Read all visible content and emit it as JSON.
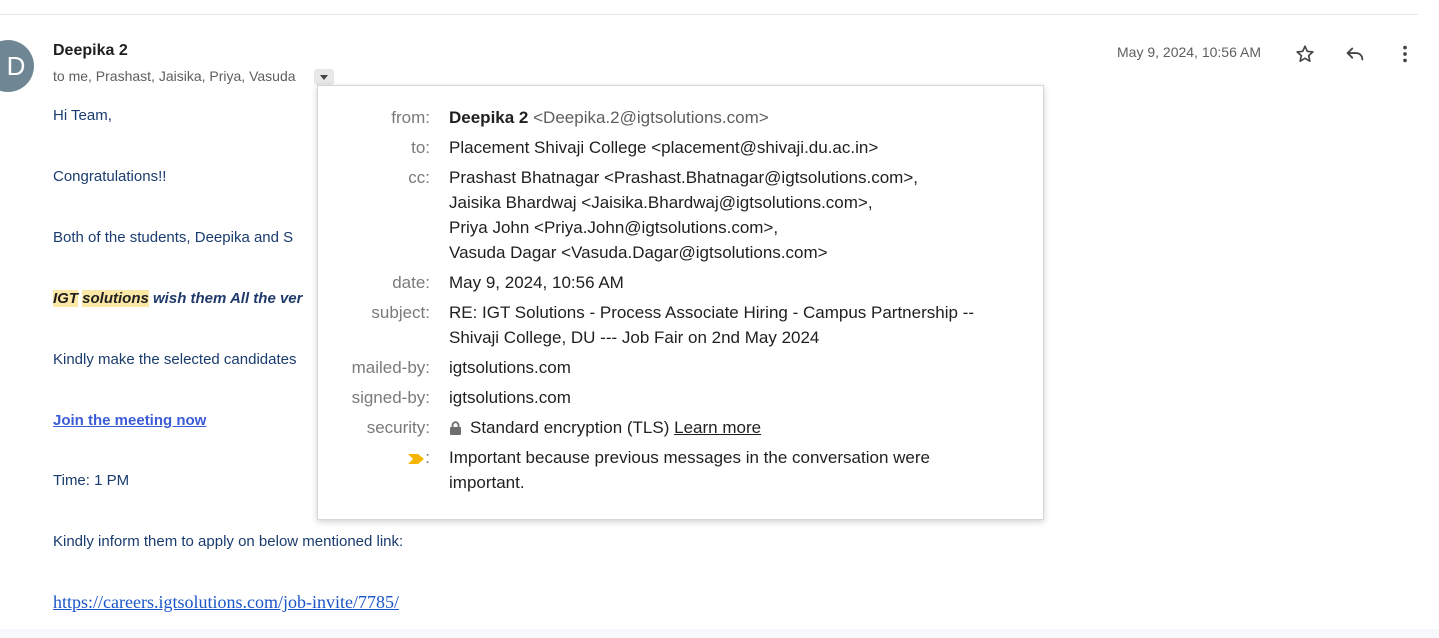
{
  "email": {
    "avatar_letter": "D",
    "sender": "Deepika 2",
    "recipients_summary": "to me, Prashast, Jaisika, Priya, Vasuda",
    "date": "May 9, 2024, 10:56 AM",
    "actions": {
      "star_icon": "star-icon",
      "reply_icon": "reply-icon",
      "more_icon": "more-vert-icon"
    },
    "body": {
      "greeting": "Hi Team,",
      "congrats": "Congratulations!!",
      "line3": "Both of the students, Deepika and S",
      "line4_hl1": "IGT",
      "line4_hl2": "solutions",
      "line4_rest": " wish them All the ver",
      "line5": "Kindly make the selected candidates",
      "meeting_link": "Join the meeting now",
      "time": "Time: 1 PM",
      "apply_text": "Kindly inform them to apply on below mentioned link:",
      "apply_url": "https://careers.igtsolutions.com/job-invite/7785/"
    }
  },
  "details": {
    "from_label": "from:",
    "from_name": "Deepika 2",
    "from_email": "<Deepika.2@igtsolutions.com>",
    "to_label": "to:",
    "to_value": "Placement Shivaji College <placement@shivaji.du.ac.in>",
    "cc_label": "cc:",
    "cc": [
      "Prashast Bhatnagar <Prashast.Bhatnagar@igtsolutions.com>,",
      "Jaisika Bhardwaj <Jaisika.Bhardwaj@igtsolutions.com>,",
      "Priya John <Priya.John@igtsolutions.com>,",
      "Vasuda Dagar <Vasuda.Dagar@igtsolutions.com>"
    ],
    "date_label": "date:",
    "date_value": "May 9, 2024, 10:56 AM",
    "subject_label": "subject:",
    "subject_lines": [
      "RE: IGT Solutions - Process Associate Hiring - Campus Partnership --",
      "Shivaji College, DU --- Job Fair on 2nd May 2024"
    ],
    "mailed_by_label": "mailed-by:",
    "mailed_by_value": "igtsolutions.com",
    "signed_by_label": "signed-by:",
    "signed_by_value": "igtsolutions.com",
    "security_label": "security:",
    "security_value": "Standard encryption (TLS)",
    "learn_more": "Learn more",
    "importance_colon": ":",
    "importance_lines": [
      "Important because previous messages in the conversation were",
      "important."
    ],
    "importance_color": "#f4b400"
  }
}
